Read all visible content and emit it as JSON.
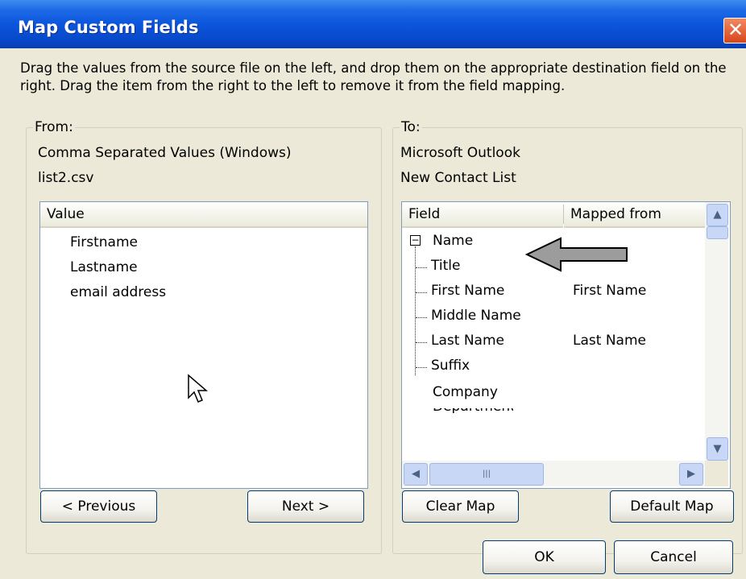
{
  "window": {
    "title": "Map Custom Fields",
    "close_glyph": "✕"
  },
  "instructions": "Drag the values from the source file on the left, and drop them on the appropriate destination field on the right.  Drag the item from the right to the left to remove it from the field mapping.",
  "from": {
    "legend": "From:",
    "source_type": "Comma Separated Values (Windows)",
    "file_name": "list2.csv",
    "column_header": "Value",
    "items": [
      "Firstname",
      "Lastname",
      "email address"
    ],
    "previous_label": "< Previous",
    "next_label": "Next >"
  },
  "to": {
    "legend": "To:",
    "app_name": "Microsoft Outlook",
    "list_name": "New Contact List",
    "columns": [
      "Field",
      "Mapped from"
    ],
    "tree": {
      "parent": "Name",
      "expander": "⊟",
      "children": [
        {
          "field": "Title",
          "mapped": ""
        },
        {
          "field": "First Name",
          "mapped": "First Name"
        },
        {
          "field": "Middle Name",
          "mapped": ""
        },
        {
          "field": "Last Name",
          "mapped": "Last Name"
        },
        {
          "field": "Suffix",
          "mapped": ""
        }
      ],
      "next_item": "Company"
    },
    "clear_map_label": "Clear Map",
    "default_map_label": "Default Map"
  },
  "footer": {
    "ok_label": "OK",
    "cancel_label": "Cancel"
  },
  "icons": {
    "scroll_up": "scroll-up-icon",
    "scroll_down": "scroll-down-icon",
    "scroll_left": "scroll-left-icon",
    "scroll_right": "scroll-right-icon",
    "annotation_arrow": "arrow-left-icon",
    "mouse_cursor": "cursor-icon"
  },
  "colors": {
    "titlebar": "#0a55dc",
    "dialog_bg": "#ece9d8",
    "close_button": "#d8451c"
  }
}
